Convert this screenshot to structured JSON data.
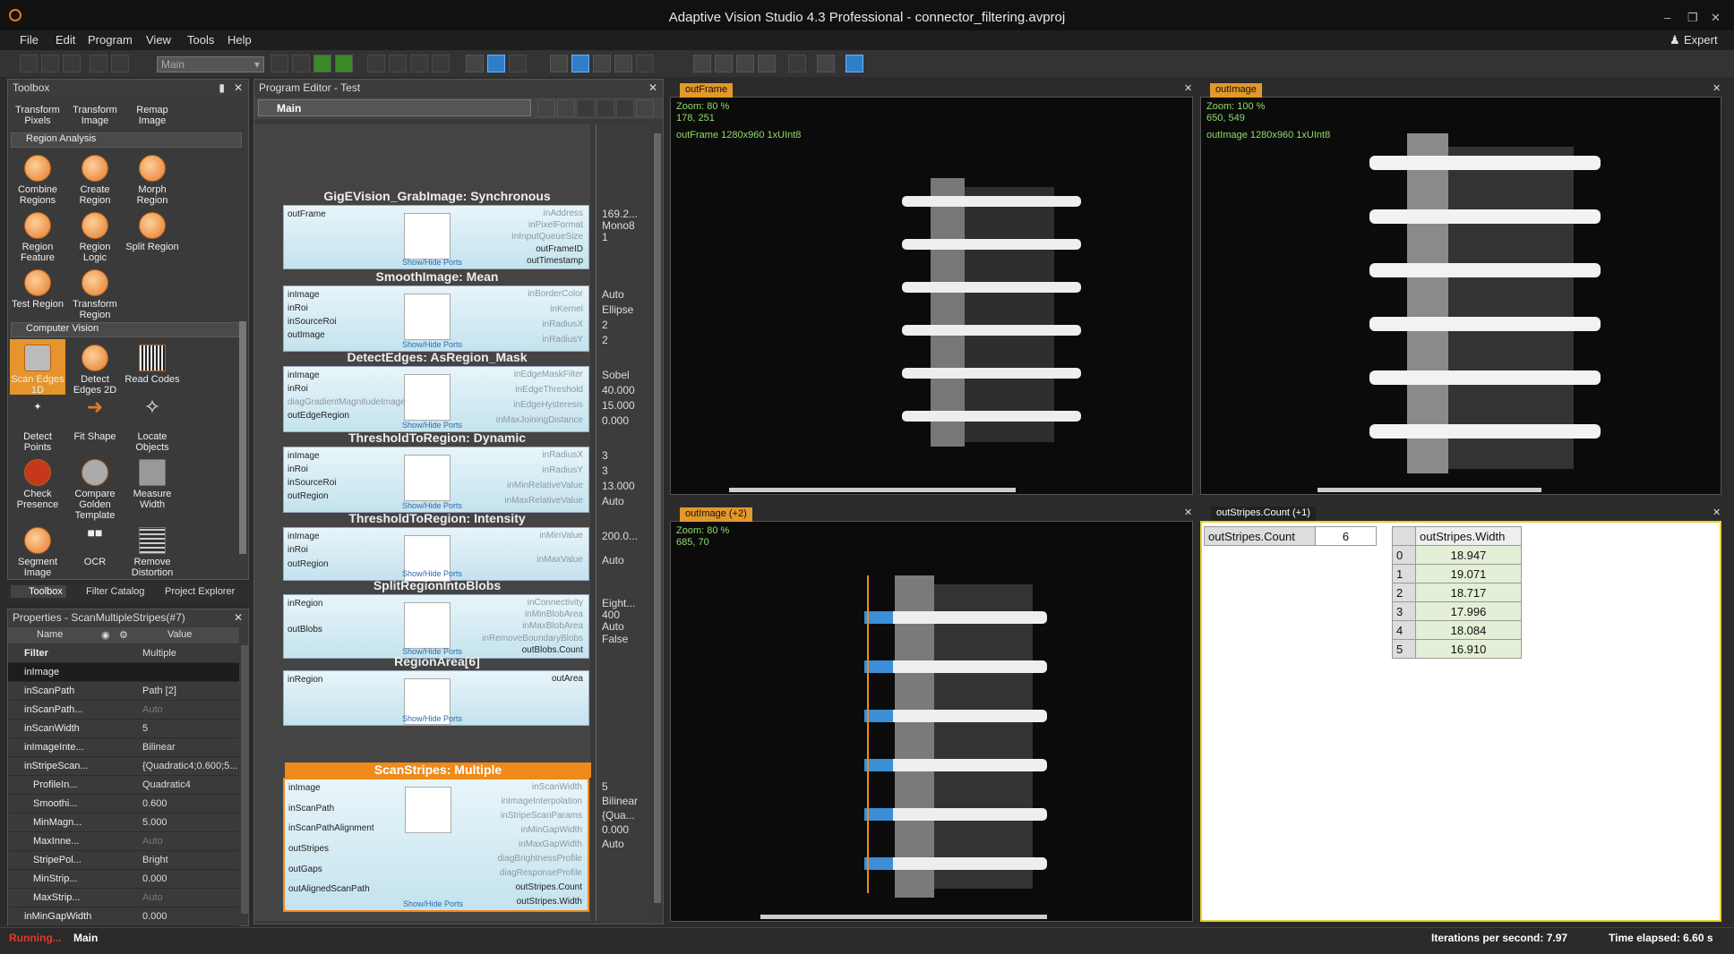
{
  "window": {
    "title": "Adaptive Vision Studio 4.3 Professional - connector_filtering.avproj",
    "user_mode": "Expert"
  },
  "menu": [
    "File",
    "Edit",
    "Program",
    "View",
    "Tools",
    "Help"
  ],
  "toolbar": {
    "program_select": "Main"
  },
  "toolbox": {
    "title": "Toolbox",
    "top_items": [
      "Transform Pixels",
      "Transform Image",
      "Remap Image"
    ],
    "section_region": "Region Analysis",
    "region_items": [
      "Combine Regions",
      "Create Region",
      "Morph Region",
      "Region Feature",
      "Region Logic",
      "Split Region",
      "Test Region",
      "Transform Region"
    ],
    "section_cv": "Computer Vision",
    "cv_items": [
      "Scan Edges 1D",
      "Detect Edges 2D",
      "Read Codes",
      "Detect Points",
      "Fit Shape",
      "Locate Objects",
      "Check Presence",
      "Compare Golden Template",
      "Measure Width",
      "Segment Image",
      "OCR",
      "Remove Distortion"
    ],
    "tabs": [
      "Toolbox",
      "Filter Catalog",
      "Project Explorer"
    ]
  },
  "properties": {
    "title": "Properties - ScanMultipleStripes(#7)",
    "col_name": "Name",
    "col_value": "Value",
    "rows": [
      {
        "n": "Filter",
        "v": "Multiple"
      },
      {
        "n": "inImage",
        "v": ""
      },
      {
        "n": "inScanPath",
        "v": "Path [2]"
      },
      {
        "n": "inScanPath...",
        "v": "Auto"
      },
      {
        "n": "inScanWidth",
        "v": "5"
      },
      {
        "n": "inImageInte...",
        "v": "Bilinear"
      },
      {
        "n": "inStripeScan...",
        "v": "{Quadratic4;0.600;5..."
      },
      {
        "n": "ProfileIn...",
        "v": "Quadratic4"
      },
      {
        "n": "Smoothi...",
        "v": "0.600"
      },
      {
        "n": "MinMagn...",
        "v": "5.000"
      },
      {
        "n": "MaxInne...",
        "v": "Auto"
      },
      {
        "n": "StripePol...",
        "v": "Bright"
      },
      {
        "n": "MinStrip...",
        "v": "0.000"
      },
      {
        "n": "MaxStrip...",
        "v": "Auto"
      },
      {
        "n": "inMinGapWidth",
        "v": "0.000"
      }
    ]
  },
  "editor": {
    "title": "Program Editor - Test",
    "macro": "Main",
    "show_hide": "Show/Hide Ports",
    "nodes": [
      {
        "name": "GigEVision_GrabImage: Synchronous",
        "left": [
          "outFrame"
        ],
        "right": [
          "inAddress",
          "inPixelFormat",
          "inInputQueueSize",
          "outFrameID",
          "outTimestamp"
        ],
        "vals": [
          "169.2...",
          "Mono8",
          "1"
        ]
      },
      {
        "name": "SmoothImage: Mean",
        "left": [
          "inImage",
          "inRoi",
          "inSourceRoi",
          "outImage"
        ],
        "right": [
          "inBorderColor",
          "inKernel",
          "inRadiusX",
          "inRadiusY"
        ],
        "vals": [
          "Auto",
          "Ellipse",
          "2",
          "2"
        ]
      },
      {
        "name": "DetectEdges: AsRegion_Mask",
        "left": [
          "inImage",
          "inRoi",
          "diagGradientMagnitudeImage",
          "outEdgeRegion"
        ],
        "right": [
          "inEdgeMaskFilter",
          "inEdgeThreshold",
          "inEdgeHysteresis",
          "inMaxJoiningDistance"
        ],
        "vals": [
          "Sobel",
          "40.000",
          "15.000",
          "0.000"
        ]
      },
      {
        "name": "ThresholdToRegion: Dynamic",
        "left": [
          "inImage",
          "inRoi",
          "inSourceRoi",
          "outRegion"
        ],
        "right": [
          "inRadiusX",
          "inRadiusY",
          "inMinRelativeValue",
          "inMaxRelativeValue"
        ],
        "vals": [
          "3",
          "3",
          "13.000",
          "Auto"
        ]
      },
      {
        "name": "ThresholdToRegion: Intensity",
        "left": [
          "inImage",
          "inRoi",
          "outRegion"
        ],
        "right": [
          "inMinValue",
          "inMaxValue"
        ],
        "vals": [
          "200.0...",
          "Auto"
        ]
      },
      {
        "name": "SplitRegionIntoBlobs",
        "left": [
          "inRegion",
          "outBlobs"
        ],
        "right": [
          "inConnectivity",
          "inMinBlobArea",
          "inMaxBlobArea",
          "inRemoveBoundaryBlobs",
          "outBlobs.Count"
        ],
        "vals": [
          "Eight...",
          "400",
          "Auto",
          "False"
        ]
      },
      {
        "name": "RegionArea[6]",
        "left": [
          "inRegion"
        ],
        "right": [
          "outArea"
        ],
        "vals": []
      },
      {
        "name": "ScanStripes: Multiple",
        "left": [
          "inImage",
          "inScanPath",
          "inScanPathAlignment",
          "outStripes",
          "outGaps",
          "outAlignedScanPath"
        ],
        "right": [
          "inScanWidth",
          "inImageInterpolation",
          "inStripeScanParams",
          "inMinGapWidth",
          "inMaxGapWidth",
          "diagBrightnessProfile",
          "diagResponseProfile",
          "outStripes.Count",
          "outStripes.Width"
        ],
        "vals": [
          "5",
          "Bilinear",
          "{Qua...",
          "0.000",
          "Auto"
        ]
      }
    ]
  },
  "views": {
    "v1": {
      "tab": "outFrame",
      "zoom": "Zoom: 80 %",
      "coords": "178, 251",
      "info": "outFrame 1280x960 1xUInt8"
    },
    "v2": {
      "tab": "outImage",
      "zoom": "Zoom: 100 %",
      "coords": "650, 549",
      "info": "outImage 1280x960 1xUInt8"
    },
    "v3": {
      "tab": "outImage (+2)",
      "zoom": "Zoom: 80 %",
      "coords": "685, 70"
    },
    "v4": {
      "tab": "outStripes.Count (+1)",
      "count_label": "outStripes.Count",
      "count_value": "6",
      "width_header": "outStripes.Width",
      "widths": [
        [
          "0",
          "18.947"
        ],
        [
          "1",
          "19.071"
        ],
        [
          "2",
          "18.717"
        ],
        [
          "3",
          "17.996"
        ],
        [
          "4",
          "18.084"
        ],
        [
          "5",
          "16.910"
        ]
      ]
    }
  },
  "status": {
    "running": "Running...",
    "macro": "Main",
    "ips": "Iterations per second: 7.97",
    "elapsed": "Time elapsed: 6.60 s"
  }
}
